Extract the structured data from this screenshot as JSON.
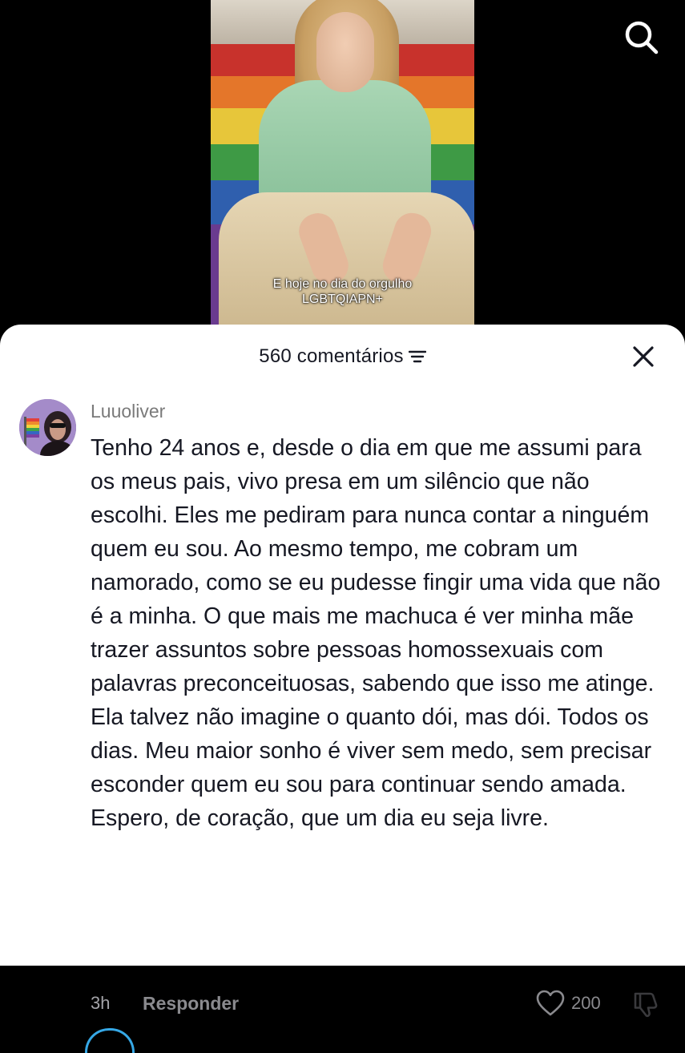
{
  "video": {
    "caption_line1": "E hoje no dia do orgulho",
    "caption_line2": "LGBTQIAPN+",
    "stair_colors": [
      "#c8322c",
      "#e4762a",
      "#e7c63a",
      "#3e9a45",
      "#2f5fae",
      "#6a3b8f"
    ]
  },
  "top_bar": {
    "search_icon": "search-icon"
  },
  "comments_sheet": {
    "count_label": "560 comentários",
    "sort_icon": "sort-icon",
    "close_icon": "close-icon"
  },
  "comment": {
    "username": "Luuoliver",
    "text": "Tenho 24 anos e, desde o dia em que me assumi para os meus pais, vivo presa em um silêncio que não escolhi. Eles me pediram para nunca contar a ninguém quem eu sou. Ao mesmo tempo, me cobram um namorado, como se eu pudesse fingir uma vida que não é a minha. O que mais me machuca é ver minha mãe trazer assuntos sobre pessoas homossexuais com palavras preconceituosas, sabendo que isso me atinge. Ela talvez não imagine o quanto dói, mas dói. Todos os dias. Meu maior sonho é viver sem medo, sem precisar esconder quem eu sou para continuar sendo amada. Espero, de coração, que um dia eu seja livre.",
    "time": "3h",
    "reply_label": "Responder",
    "like_count": "200",
    "like_icon": "heart-icon",
    "dislike_icon": "thumbs-down-icon"
  },
  "colors": {
    "text_primary": "#161823",
    "text_secondary": "#8a8a8e",
    "accent_avatar_ring": "#36a8e6"
  }
}
